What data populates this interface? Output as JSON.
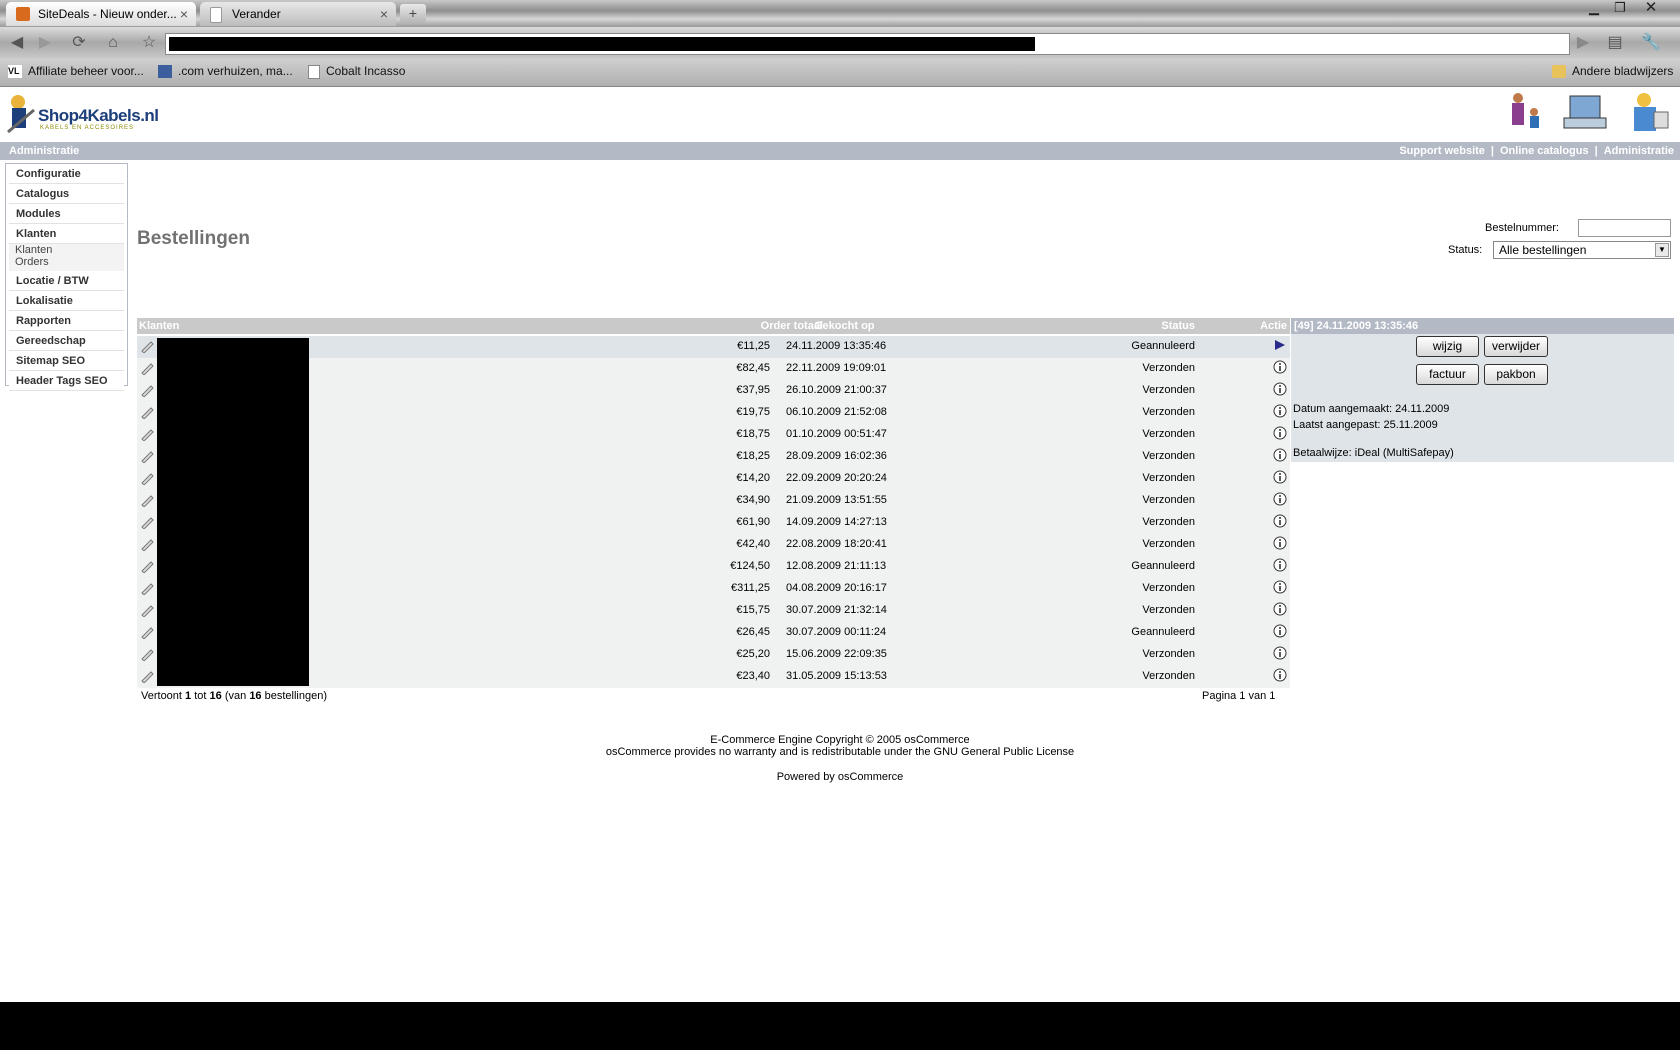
{
  "browser": {
    "tabs": [
      {
        "title": "SiteDeals - Nieuw onder...",
        "active": true
      },
      {
        "title": "Verander",
        "active": false
      }
    ],
    "new_tab_glyph": "+",
    "close_glyph": "×",
    "bookmarks": [
      {
        "label": "Affiliate beheer voor...",
        "icon": "vl-favicon-icon"
      },
      {
        "label": ".com verhuizen, ma...",
        "icon": "site-favicon-icon"
      },
      {
        "label": "Cobalt Incasso",
        "icon": "page-icon"
      }
    ],
    "other_bookmarks": "Andere bladwijzers"
  },
  "header": {
    "logo_title": "Shop4Kabels.nl",
    "logo_subtitle": "KABELS EN ACCESOIRES",
    "admin_label": "Administratie",
    "links": [
      "Support website",
      "Online catalogus",
      "Administratie"
    ],
    "separator": "|"
  },
  "sidebar": {
    "items": [
      {
        "label": "Configuratie"
      },
      {
        "label": "Catalogus"
      },
      {
        "label": "Modules"
      },
      {
        "label": "Klanten",
        "subitems": [
          "Klanten",
          "Orders"
        ]
      },
      {
        "label": "Locatie / BTW"
      },
      {
        "label": "Lokalisatie"
      },
      {
        "label": "Rapporten"
      },
      {
        "label": "Gereedschap"
      },
      {
        "label": "Sitemap SEO"
      },
      {
        "label": "Header Tags SEO"
      }
    ]
  },
  "main": {
    "title": "Bestellingen",
    "filters": {
      "order_number_label": "Bestelnummer:",
      "order_number_value": "",
      "status_label": "Status:",
      "status_value": "Alle bestellingen"
    },
    "table": {
      "columns": {
        "customers": "Klanten",
        "total": "Order totaal",
        "bought_on": "Gekocht op",
        "status": "Status",
        "action": "Actie"
      },
      "rows": [
        {
          "total": "€11,25",
          "date": "24.11.2009 13:35:46",
          "status": "Geannuleerd",
          "selected": true
        },
        {
          "total": "€82,45",
          "date": "22.11.2009 19:09:01",
          "status": "Verzonden"
        },
        {
          "total": "€37,95",
          "date": "26.10.2009 21:00:37",
          "status": "Verzonden"
        },
        {
          "total": "€19,75",
          "date": "06.10.2009 21:52:08",
          "status": "Verzonden"
        },
        {
          "total": "€18,75",
          "date": "01.10.2009 00:51:47",
          "status": "Verzonden"
        },
        {
          "total": "€18,25",
          "date": "28.09.2009 16:02:36",
          "status": "Verzonden"
        },
        {
          "total": "€14,20",
          "date": "22.09.2009 20:20:24",
          "status": "Verzonden"
        },
        {
          "total": "€34,90",
          "date": "21.09.2009 13:51:55",
          "status": "Verzonden"
        },
        {
          "total": "€61,90",
          "date": "14.09.2009 14:27:13",
          "status": "Verzonden"
        },
        {
          "total": "€42,40",
          "date": "22.08.2009 18:20:41",
          "status": "Verzonden"
        },
        {
          "total": "€124,50",
          "date": "12.08.2009 21:11:13",
          "status": "Geannuleerd"
        },
        {
          "total": "€311,25",
          "date": "04.08.2009 20:16:17",
          "status": "Verzonden"
        },
        {
          "total": "€15,75",
          "date": "30.07.2009 21:32:14",
          "status": "Verzonden"
        },
        {
          "total": "€26,45",
          "date": "30.07.2009 00:11:24",
          "status": "Geannuleerd"
        },
        {
          "total": "€25,20",
          "date": "15.06.2009 22:09:35",
          "status": "Verzonden"
        },
        {
          "total": "€23,40",
          "date": "31.05.2009 15:13:53",
          "status": "Verzonden"
        }
      ],
      "showing": {
        "prefix": "Vertoont",
        "from": "1",
        "to_word": "tot",
        "to": "16",
        "of_open": "(van",
        "total": "16",
        "suffix": "bestellingen)"
      },
      "pagination": "Pagina 1 van 1"
    },
    "info_panel": {
      "header": "[49]  24.11.2009 13:35:46",
      "buttons": {
        "edit": "wijzig",
        "delete": "verwijder",
        "invoice": "factuur",
        "packing_slip": "pakbon"
      },
      "created": "Datum aangemaakt: 24.11.2009",
      "modified": "Laatst aangepast: 25.11.2009",
      "payment": "Betaalwijze: iDeal (MultiSafepay)"
    }
  },
  "footer": {
    "line1": "E-Commerce Engine Copyright © 2005 osCommerce",
    "line2": "osCommerce provides no warranty and is redistributable under the GNU General Public License",
    "line3": "Powered by osCommerce"
  }
}
